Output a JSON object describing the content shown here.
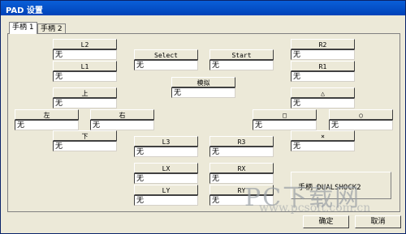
{
  "window": {
    "title": "PAD 设置"
  },
  "tabs": [
    {
      "label": "手柄 1",
      "active": true
    },
    {
      "label": "手柄 2",
      "active": false
    }
  ],
  "controls": [
    {
      "id": "l2",
      "label": "L2",
      "value": "无"
    },
    {
      "id": "l1",
      "label": "L1",
      "value": "无"
    },
    {
      "id": "up",
      "label": "上",
      "value": "无"
    },
    {
      "id": "left",
      "label": "左",
      "value": "无"
    },
    {
      "id": "right",
      "label": "右",
      "value": "无"
    },
    {
      "id": "down",
      "label": "下",
      "value": "无"
    },
    {
      "id": "select",
      "label": "Select",
      "value": "无"
    },
    {
      "id": "start",
      "label": "Start",
      "value": "无"
    },
    {
      "id": "analog",
      "label": "模拟",
      "value": "无"
    },
    {
      "id": "l3",
      "label": "L3",
      "value": "无"
    },
    {
      "id": "r3",
      "label": "R3",
      "value": "无"
    },
    {
      "id": "lx",
      "label": "LX",
      "value": "无"
    },
    {
      "id": "rx",
      "label": "RX",
      "value": "无"
    },
    {
      "id": "ly",
      "label": "LY",
      "value": "无"
    },
    {
      "id": "ry",
      "label": "RY",
      "value": "无"
    },
    {
      "id": "r2",
      "label": "R2",
      "value": "无"
    },
    {
      "id": "r1",
      "label": "R1",
      "value": "无"
    },
    {
      "id": "triangle",
      "label": "△",
      "value": "无"
    },
    {
      "id": "square",
      "label": "□",
      "value": "无"
    },
    {
      "id": "circle",
      "label": "○",
      "value": "无"
    },
    {
      "id": "cross",
      "label": "×",
      "value": "无"
    }
  ],
  "group": {
    "label": "手柄 DUALSHOCK2"
  },
  "buttons": {
    "ok": "确定",
    "cancel": "取消"
  },
  "watermark": {
    "main": "PC下载网",
    "sub": "www.pcsoft.com.cn"
  }
}
